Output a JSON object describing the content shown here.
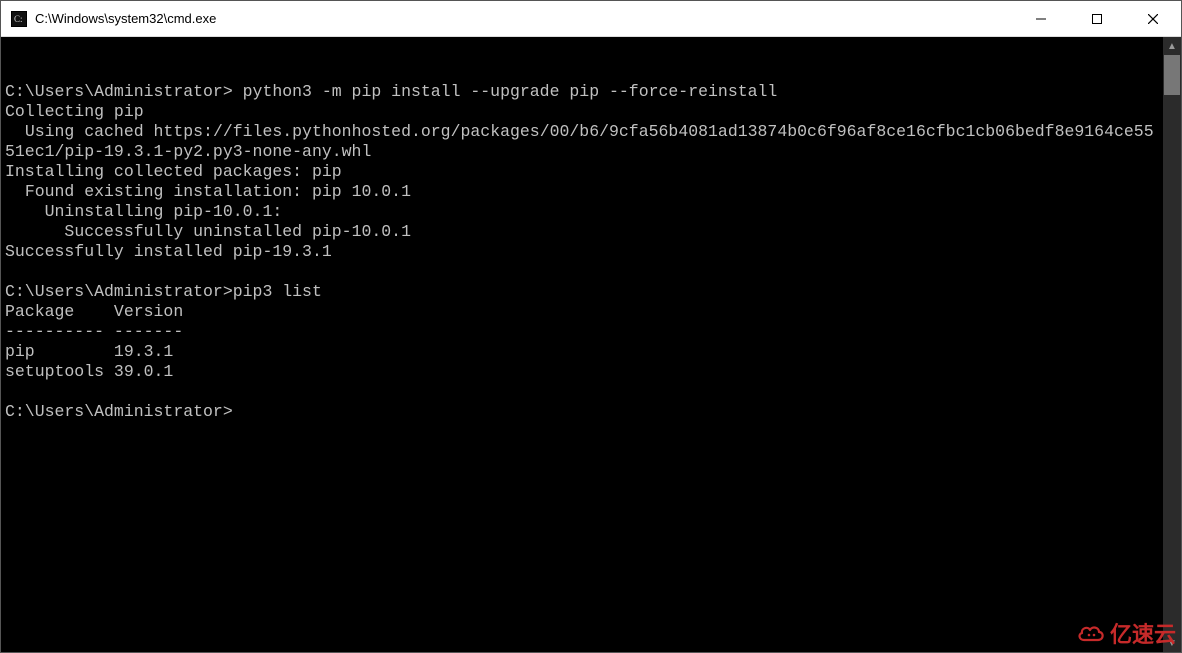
{
  "window": {
    "title": "C:\\Windows\\system32\\cmd.exe"
  },
  "terminal": {
    "lines": [
      "",
      "C:\\Users\\Administrator> python3 -m pip install --upgrade pip --force-reinstall",
      "Collecting pip",
      "  Using cached https://files.pythonhosted.org/packages/00/b6/9cfa56b4081ad13874b0c6f96af8ce16cfbc1cb06bedf8e9164ce5551ec1/pip-19.3.1-py2.py3-none-any.whl",
      "Installing collected packages: pip",
      "  Found existing installation: pip 10.0.1",
      "    Uninstalling pip-10.0.1:",
      "      Successfully uninstalled pip-10.0.1",
      "Successfully installed pip-19.3.1",
      "",
      "C:\\Users\\Administrator>pip3 list",
      "Package    Version",
      "---------- -------",
      "pip        19.3.1",
      "setuptools 39.0.1",
      "",
      "C:\\Users\\Administrator>"
    ]
  },
  "watermark": {
    "text": "亿速云"
  }
}
